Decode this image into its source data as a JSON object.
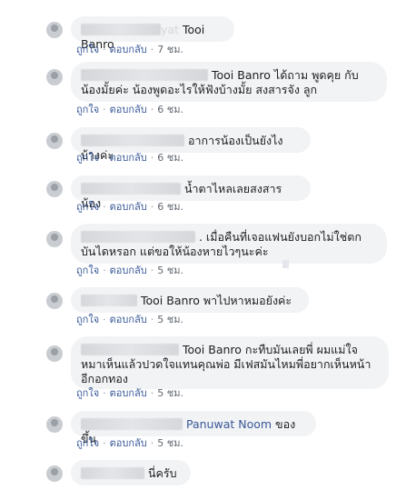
{
  "comments": [
    {
      "pre": "",
      "name_tail": "yat",
      "name": "Tooi Banro",
      "body": "",
      "likes": "ถูกใจ",
      "reply": "ตอบกลับ",
      "time": "7 ชม."
    },
    {
      "pre": "",
      "name": "Tooi Banro",
      "body": "ได้ถาม พูดคุย กับน้องมั้ยค่ะ น้องพูดอะไรให้ฟังบ้างมั้ย สงสารจัง ลูก",
      "likes": "ถูกใจ",
      "reply": "ตอบกลับ",
      "time": "6 ชม."
    },
    {
      "pre": "",
      "name": "",
      "body": "อาการน้องเป็นยังไงบ้างค่ะ",
      "likes": "ถูกใจ",
      "reply": "ตอบกลับ",
      "time": "6 ชม."
    },
    {
      "pre": "",
      "name": "",
      "body": "น้ำตาไหลเลยสงสารน้อง",
      "likes": "ถูกใจ",
      "reply": "ตอบกลับ",
      "time": "6 ชม."
    },
    {
      "pre": "",
      "name": "",
      "body": ". เมื่อคืนที่เจอแฟนยังบอกไม่ใช่ตกบันไดหรอก แต่ขอให้น้องหายไวๆนะค่ะ",
      "likes": "ถูกใจ",
      "reply": "ตอบกลับ",
      "time": "5 ชม."
    },
    {
      "pre": "",
      "name": "Tooi Banro",
      "body": "พาไปหาหมอยังค่ะ",
      "likes": "ถูกใจ",
      "reply": "ตอบกลับ",
      "time": "5 ชม."
    },
    {
      "pre": "",
      "name": "Tooi Banro",
      "body": "กะทืบมันเลยพี่ ผมแม่ใจหมาเห็นแล้วปวดใจแทนคุณพ่อ มีเฟสมันไหมพี่อยากเห็นหน้าอีกอกทอง",
      "likes": "ถูกใจ",
      "reply": "ตอบกลับ",
      "time": "5 ชม."
    },
    {
      "pre": "",
      "name": "Panuwat Noom",
      "body": "ของขึ้น",
      "likes": "ถูกใจ",
      "reply": "ตอบกลับ",
      "time": "5 ชม."
    },
    {
      "pre": "",
      "name": "",
      "body": "นี่ครับ"
    }
  ],
  "colors": {
    "bubble": "#f2f3f5",
    "link": "#385898",
    "meta": "#606770"
  },
  "icons": {
    "avatar": "profile-avatar-icon"
  }
}
